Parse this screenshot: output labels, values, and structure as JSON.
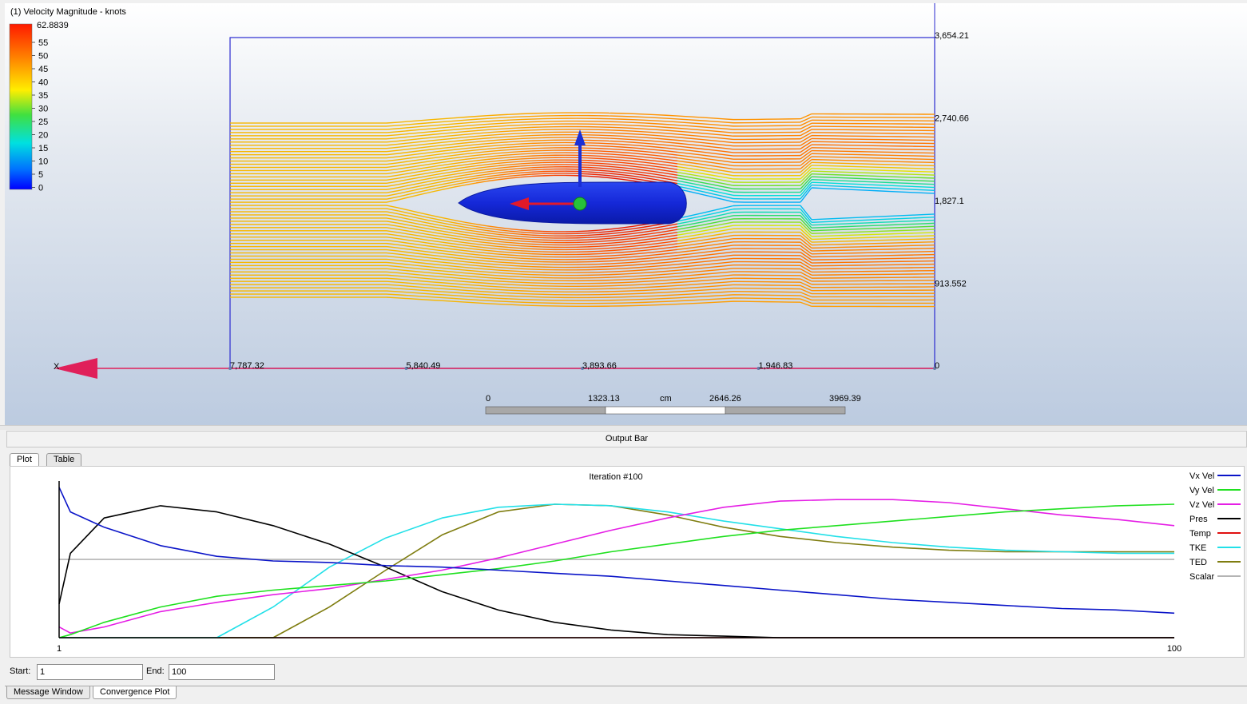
{
  "viewport": {
    "legend_title": "(1) Velocity Magnitude - knots",
    "legend_max": "62.8839",
    "legend_ticks": [
      "55",
      "50",
      "45",
      "40",
      "35",
      "30",
      "25",
      "20",
      "15",
      "10",
      "5",
      "0"
    ],
    "right_axis_labels": [
      "3,654.21",
      "2,740.66",
      "1,827.1",
      "913.552"
    ],
    "bottom_axis_labels": [
      "7,787.32",
      "5,840.49",
      "3,893.66",
      "1,946.83",
      "0"
    ],
    "x_axis_letter": "X",
    "scale_bar": {
      "labels": [
        "0",
        "1323.13",
        "2646.26",
        "3969.39"
      ],
      "unit": "cm"
    },
    "colors": {
      "body": "#1a2fd6",
      "arrow_red": "#e21a2a",
      "arrow_blue": "#1a2fd6",
      "axis_pink": "#e0205a",
      "box": "#2b2bd0"
    }
  },
  "output_bar": {
    "title": "Output Bar"
  },
  "tabs": [
    {
      "label": "Plot",
      "active": true
    },
    {
      "label": "Table",
      "active": false
    }
  ],
  "plot": {
    "title": "Iteration #100",
    "x_start_label": "1",
    "x_end_label": "100",
    "legend": [
      {
        "name": "Vx Vel",
        "color": "#0a14c8"
      },
      {
        "name": "Vy Vel",
        "color": "#1fe01f"
      },
      {
        "name": "Vz Vel",
        "color": "#e51ee5"
      },
      {
        "name": "Pres",
        "color": "#000000"
      },
      {
        "name": "Temp",
        "color": "#e01010"
      },
      {
        "name": "TKE",
        "color": "#22e0e8"
      },
      {
        "name": "TED",
        "color": "#7f7d10"
      },
      {
        "name": "Scalar",
        "color": "#b4b4b4"
      }
    ]
  },
  "range": {
    "start_label": "Start:",
    "start_value": "1",
    "end_label": "End:",
    "end_value": "100"
  },
  "bottom_tabs": [
    {
      "label": "Message Window",
      "active": false
    },
    {
      "label": "Convergence Plot",
      "active": true
    }
  ],
  "chart_data": {
    "type": "line",
    "title": "Iteration #100",
    "xlim": [
      1,
      100
    ],
    "x": [
      1,
      2,
      5,
      10,
      15,
      20,
      25,
      30,
      35,
      40,
      45,
      50,
      55,
      60,
      65,
      70,
      75,
      80,
      85,
      90,
      95,
      100
    ],
    "ylabel": "",
    "xlabel": "",
    "series": [
      {
        "name": "Vx Vel",
        "values": [
          0.98,
          0.82,
          0.72,
          0.6,
          0.53,
          0.5,
          0.49,
          0.47,
          0.46,
          0.44,
          0.42,
          0.4,
          0.37,
          0.34,
          0.31,
          0.28,
          0.25,
          0.23,
          0.21,
          0.19,
          0.18,
          0.16
        ]
      },
      {
        "name": "Vy Vel",
        "values": [
          0.0,
          0.02,
          0.1,
          0.2,
          0.27,
          0.31,
          0.34,
          0.37,
          0.41,
          0.45,
          0.5,
          0.56,
          0.61,
          0.66,
          0.7,
          0.73,
          0.76,
          0.79,
          0.82,
          0.84,
          0.86,
          0.87
        ]
      },
      {
        "name": "Vz Vel",
        "values": [
          0.07,
          0.03,
          0.07,
          0.17,
          0.23,
          0.28,
          0.32,
          0.38,
          0.44,
          0.52,
          0.61,
          0.7,
          0.78,
          0.85,
          0.89,
          0.9,
          0.9,
          0.88,
          0.84,
          0.8,
          0.77,
          0.73
        ]
      },
      {
        "name": "Pres",
        "values": [
          0.22,
          0.55,
          0.78,
          0.86,
          0.82,
          0.73,
          0.61,
          0.46,
          0.3,
          0.18,
          0.1,
          0.05,
          0.02,
          0.01,
          0.0,
          0.0,
          0.0,
          0.0,
          0.0,
          0.0,
          0.0,
          0.0
        ]
      },
      {
        "name": "Temp",
        "values": [
          0.0,
          0.0,
          0.0,
          0.0,
          0.0,
          0.0,
          0.0,
          0.0,
          0.0,
          0.0,
          0.0,
          0.0,
          0.0,
          0.0,
          0.0,
          0.0,
          0.0,
          0.0,
          0.0,
          0.0,
          0.0,
          0.0
        ]
      },
      {
        "name": "TKE",
        "values": [
          0.0,
          0.0,
          0.0,
          0.0,
          0.0,
          0.2,
          0.46,
          0.65,
          0.78,
          0.85,
          0.87,
          0.86,
          0.82,
          0.76,
          0.71,
          0.66,
          0.62,
          0.59,
          0.57,
          0.56,
          0.55,
          0.55
        ]
      },
      {
        "name": "TED",
        "values": [
          0.0,
          0.0,
          0.0,
          0.0,
          0.0,
          0.0,
          0.2,
          0.44,
          0.67,
          0.82,
          0.87,
          0.86,
          0.8,
          0.72,
          0.66,
          0.62,
          0.59,
          0.57,
          0.56,
          0.56,
          0.56,
          0.56
        ]
      },
      {
        "name": "Scalar",
        "values": [
          0.51,
          0.51,
          0.51,
          0.51,
          0.51,
          0.51,
          0.51,
          0.51,
          0.51,
          0.51,
          0.51,
          0.51,
          0.51,
          0.51,
          0.51,
          0.51,
          0.51,
          0.51,
          0.51,
          0.51,
          0.51,
          0.51
        ]
      }
    ],
    "grid": false,
    "legend": "right"
  }
}
